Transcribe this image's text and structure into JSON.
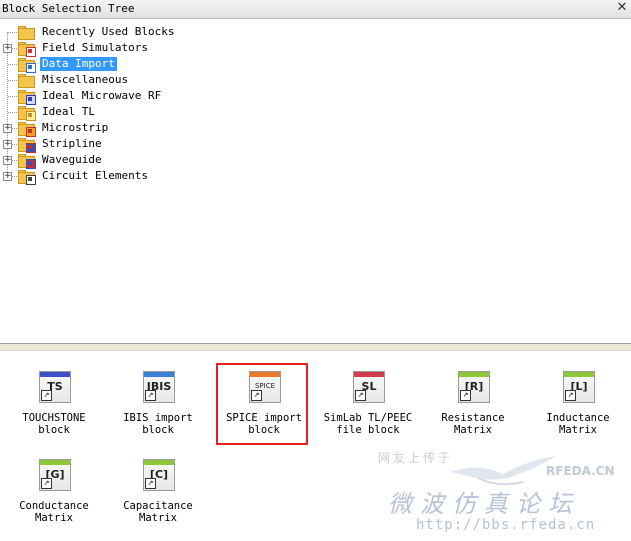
{
  "window": {
    "title": "Block Selection Tree"
  },
  "tree": {
    "items": [
      {
        "label": "Recently Used Blocks",
        "expandable": false,
        "selected": false,
        "icon": "folder-icon"
      },
      {
        "label": "Field Simulators",
        "expandable": true,
        "selected": false,
        "icon": "field-simulators-folder-icon"
      },
      {
        "label": "Data Import",
        "expandable": false,
        "selected": true,
        "icon": "data-import-folder-icon"
      },
      {
        "label": "Miscellaneous",
        "expandable": false,
        "selected": false,
        "icon": "folder-icon"
      },
      {
        "label": "Ideal Microwave RF",
        "expandable": false,
        "selected": false,
        "icon": "microwave-folder-icon"
      },
      {
        "label": "Ideal TL",
        "expandable": false,
        "selected": false,
        "icon": "tl-folder-icon"
      },
      {
        "label": "Microstrip",
        "expandable": true,
        "selected": false,
        "icon": "microstrip-folder-icon"
      },
      {
        "label": "Stripline",
        "expandable": true,
        "selected": false,
        "icon": "stripline-folder-icon"
      },
      {
        "label": "Waveguide",
        "expandable": true,
        "selected": false,
        "icon": "waveguide-folder-icon"
      },
      {
        "label": "Circuit Elements",
        "expandable": true,
        "selected": false,
        "icon": "circuit-elements-folder-icon"
      }
    ]
  },
  "blocks": {
    "items": [
      {
        "label": "TOUCHSTONE block",
        "symbol": "TS",
        "icon": "touchstone-block-icon",
        "accent": "#3a4fc8"
      },
      {
        "label": "IBIS import block",
        "symbol": "IBIS",
        "icon": "ibis-block-icon",
        "accent": "#3a7fd8"
      },
      {
        "label": "SPICE import block",
        "symbol": "SPICE",
        "icon": "spice-block-icon",
        "accent": "#e87a2a",
        "highlighted": true
      },
      {
        "label": "SimLab TL/PEEC file block",
        "symbol": "SL",
        "icon": "simlab-block-icon",
        "accent": "#d23c4a"
      },
      {
        "label": "Resistance Matrix",
        "symbol": "[R]",
        "icon": "resistance-matrix-icon",
        "accent": "#8cc83a"
      },
      {
        "label": "Inductance Matrix",
        "symbol": "[L]",
        "icon": "inductance-matrix-icon",
        "accent": "#8cc83a"
      },
      {
        "label": "Conductance Matrix",
        "symbol": "[G]",
        "icon": "conductance-matrix-icon",
        "accent": "#8cc83a"
      },
      {
        "label": "Capacitance Matrix",
        "symbol": "[C]",
        "icon": "capacitance-matrix-icon",
        "accent": "#8cc83a"
      }
    ],
    "highlight_color": "#e02020"
  },
  "watermark": {
    "line1": "网友上传于",
    "brand": "RFEDA.CN",
    "title": "微波仿真论坛",
    "url": "http://bbs.rfeda.cn"
  },
  "colors": {
    "selection": "#3399ff",
    "folder": "#f5c54b"
  }
}
